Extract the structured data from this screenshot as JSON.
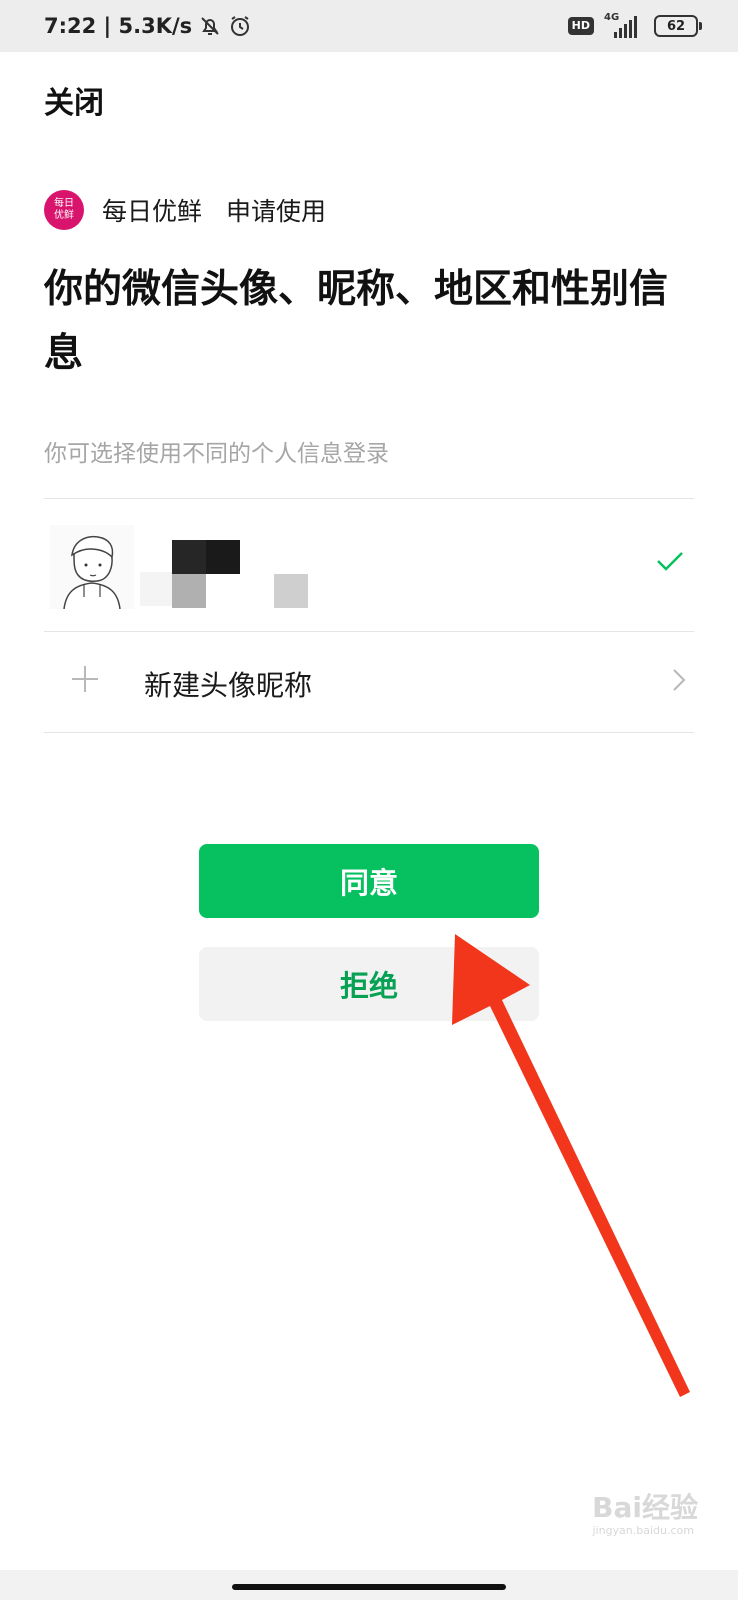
{
  "status_bar": {
    "time_speed": "7:22 | 5.3K/s",
    "network_type": "4G",
    "hd_label": "HD",
    "battery": "62",
    "icons": [
      "mute-bell-icon",
      "alarm-icon",
      "hd-icon",
      "signal-icon",
      "battery-icon"
    ]
  },
  "header": {
    "close_label": "关闭"
  },
  "app": {
    "logo_text_line1": "每日",
    "logo_text_line2": "优鲜",
    "name": "每日优鲜",
    "request_text": "申请使用",
    "brand_color": "#d9146d"
  },
  "title": "你的微信头像、昵称、地区和性别信息",
  "hint": "你可选择使用不同的个人信息登录",
  "profile_option": {
    "selected": true,
    "check_color": "#07c160"
  },
  "new_option": {
    "label": "新建头像昵称"
  },
  "buttons": {
    "agree": "同意",
    "reject": "拒绝",
    "agree_color": "#07c160"
  },
  "annotation": {
    "arrow_color": "#f2361b"
  },
  "watermark": {
    "text": "Bai经验",
    "sub": "jingyan.baidu.com"
  }
}
